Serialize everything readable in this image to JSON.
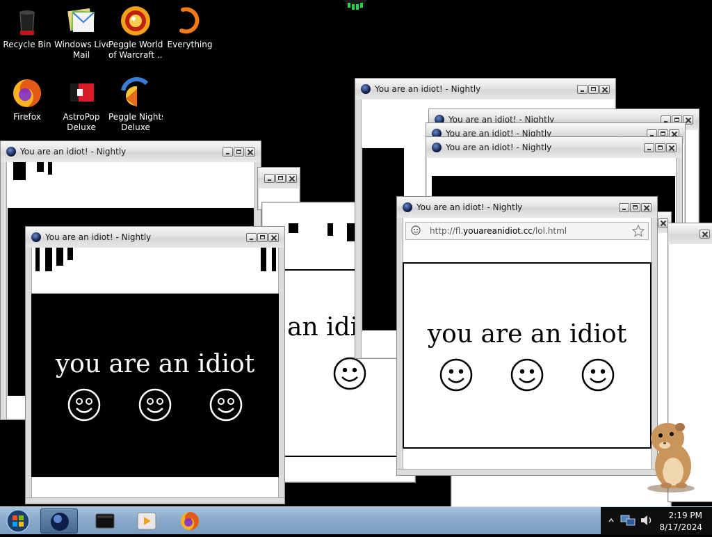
{
  "desktop_icons": [
    {
      "label_1": "Recycle Bin",
      "label_2": "",
      "icon": "recycle-bin-icon"
    },
    {
      "label_1": "Windows Live",
      "label_2": "Mail",
      "icon": "mail-icon"
    },
    {
      "label_1": "Peggle World",
      "label_2": "of Warcraft ...",
      "icon": "peggle-world-icon"
    },
    {
      "label_1": "Everything",
      "label_2": "",
      "icon": "everything-icon"
    },
    {
      "label_1": "Firefox",
      "label_2": "",
      "icon": "firefox-icon"
    },
    {
      "label_1": "AstroPop",
      "label_2": "Deluxe",
      "icon": "astropop-icon"
    },
    {
      "label_1": "Peggle Nights",
      "label_2": "Deluxe",
      "icon": "peggle-nights-icon"
    }
  ],
  "window": {
    "title": "You are an idiot! - Nightly",
    "message": "you are an idiot",
    "url_prefix": "http://fl.",
    "url_host": "youareanidiot.cc",
    "url_path": "/lol.html"
  },
  "partial_text": {
    "an_idio": "an idio"
  },
  "taskbar": {
    "time": "2:19 PM",
    "date": "8/17/2024"
  },
  "colors": {
    "desktop_bg": "#000000",
    "taskbar": "#89a9c9"
  }
}
